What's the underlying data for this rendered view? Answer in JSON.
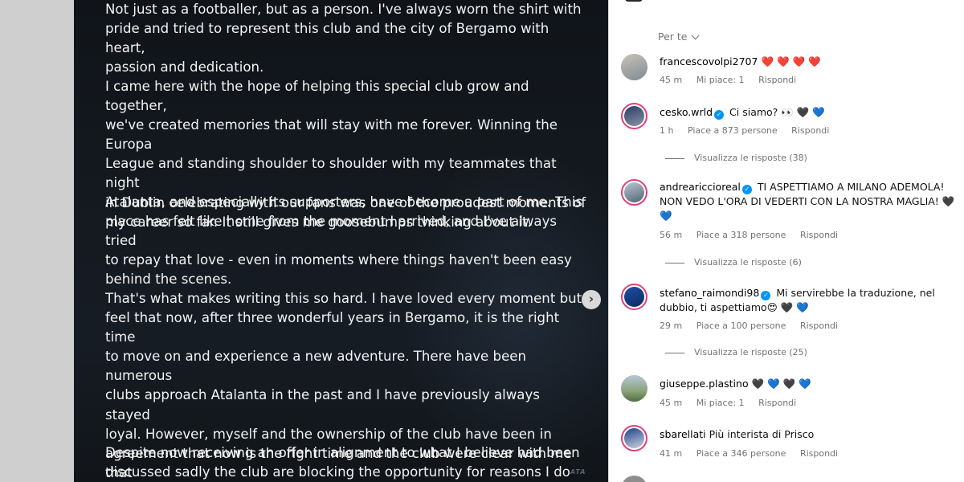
{
  "post": {
    "paragraphs": [
      "Not just as a footballer, but as a person. I've always worn the shirt with\npride and tried to represent this club and the city of Bergamo with heart,\npassion and dedication.",
      "I came here with the hope of helping this special club grow and together,\nwe've created memories that will stay with me forever. Winning the Europa\nLeague and standing shoulder to shoulder with my teammates that night\nin Dublin celebrating with our fans was one of the proudest moments of\nmy career so far. It still gives me goosebumps thinking about it.",
      "Atalanta, and especially its supporters, have become a part of me. This\nplace has felt like home from the moment I arrived, and I've always tried\nto repay that love - even in moments where things haven't been easy\nbehind the scenes.",
      "That's what makes writing this so hard. I have loved every moment but\nfeel that now, after three wonderful years in Bergamo, it is the right time\nto move on and experience a new adventure. There have been numerous\nclubs approach Atalanta in the past and I have previously always stayed\nloyal. However, myself and the ownership of the club have been in\nagreement that now is the right time and the club were clear with me that\nif a fair offer came in they would allow me to move.",
      "Despite now receiving an offer in alignment to what I believe had been\ndiscussed sadly the club are blocking the opportunity for reasons I do not"
    ],
    "next_icon": "chevron-right-icon",
    "watermark": "ATA"
  },
  "comments": {
    "sort_label": "Per te",
    "items": [
      {
        "username": "francescovolpi2707",
        "verified": false,
        "text": "❤️ ❤️ ❤️ ❤️",
        "time": "45 m",
        "likes": "Mi piace: 1",
        "reply": "Rispondi"
      },
      {
        "username": "cesko.wrld",
        "verified": true,
        "text": "Ci siamo? 👀 🖤 💙",
        "time": "1 h",
        "likes": "Piace a 873 persone",
        "reply": "Rispondi",
        "view_replies": "Visualizza le risposte (38)"
      },
      {
        "username": "andreariccioreal",
        "verified": true,
        "text": "TI ASPETTIAMO A MILANO ADEMOLA! NON VEDO L'ORA DI VEDERTI CON LA NOSTRA MAGLIA! 🖤 💙",
        "time": "56 m",
        "likes": "Piace a 318 persone",
        "reply": "Rispondi",
        "view_replies": "Visualizza le risposte (6)"
      },
      {
        "username": "stefano_raimondi98",
        "verified": true,
        "text": "Mi servirebbe la traduzione, nel dubbio, ti aspettiamo😍 🖤 💙",
        "time": "29 m",
        "likes": "Piace a 100 persone",
        "reply": "Rispondi",
        "view_replies": "Visualizza le risposte (25)"
      },
      {
        "username": "giuseppe.plastino",
        "verified": false,
        "text": "🖤 💙 🖤 💙",
        "time": "45 m",
        "likes": "Mi piace: 1",
        "reply": "Rispondi"
      },
      {
        "username": "sbarellati",
        "verified": false,
        "text": "Più interista di Prisco",
        "time": "41 m",
        "likes": "Piace a 346 persone",
        "reply": "Rispondi"
      }
    ]
  },
  "colors": {
    "verified": "#0095f6",
    "meta": "#737373",
    "story_ring": "#e33d7a",
    "media_bg": "#14191f"
  }
}
